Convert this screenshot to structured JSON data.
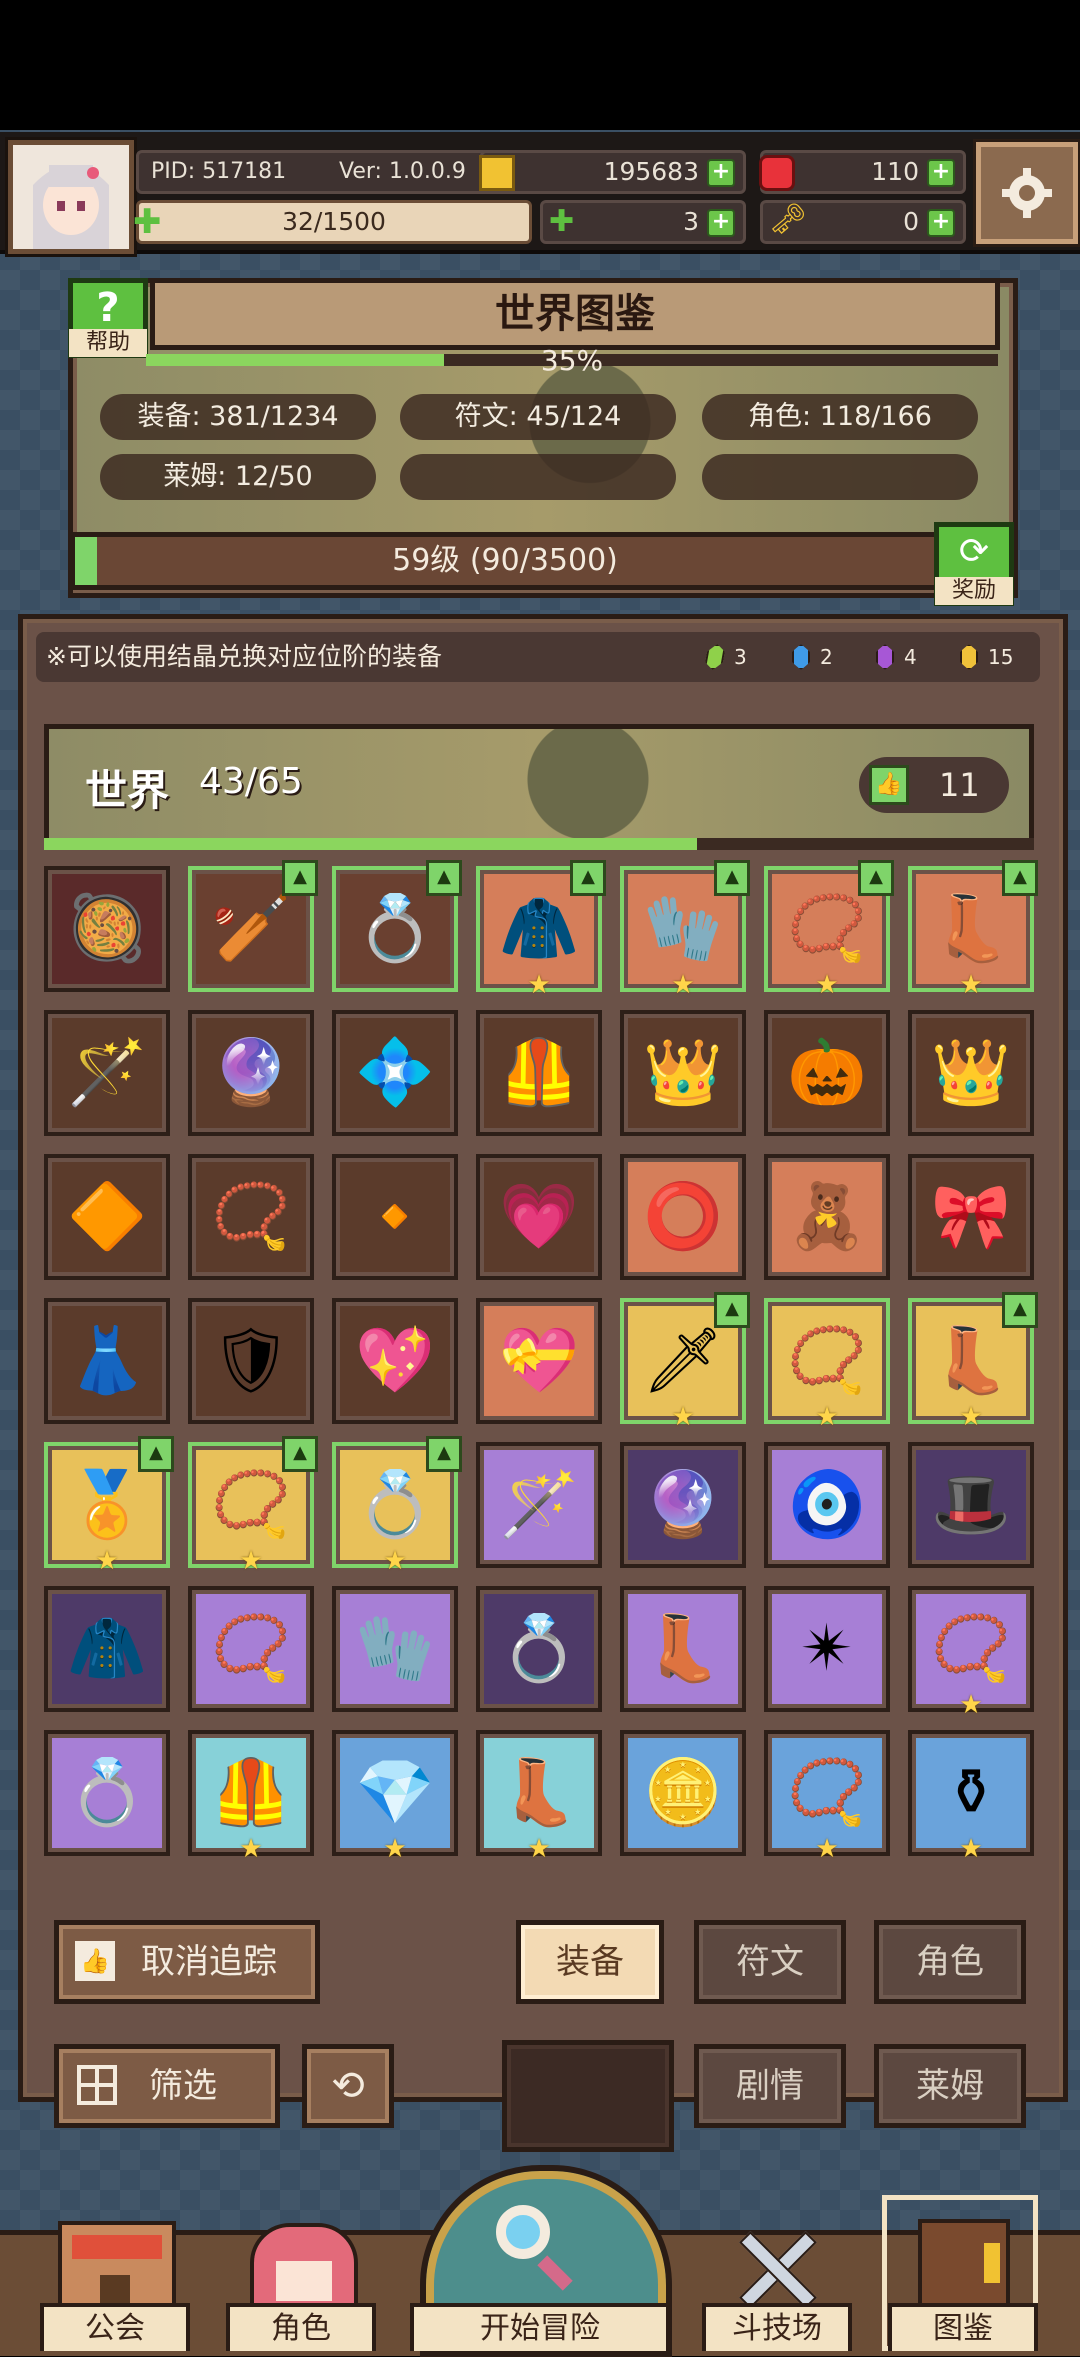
{
  "header": {
    "pid": "PID: 517181",
    "version": "Ver: 1.0.0.9",
    "gold": "195683",
    "gems": "110",
    "stamina": "32/1500",
    "clover": "3",
    "key": "0"
  },
  "codex": {
    "title": "世界图鉴",
    "help": "帮助",
    "percent": "35%",
    "percent_value": 0.35,
    "stats": [
      "装备: 381/1234",
      "符文: 45/124",
      "角色: 118/166",
      "莱姆: 12/50"
    ],
    "level": "59级 (90/3500)",
    "level_fraction": 0.026,
    "reward": "奖励"
  },
  "collection": {
    "note": "※可以使用结晶兑换对应位阶的装备",
    "crystals": [
      {
        "color": "#8fd14a",
        "count": "3"
      },
      {
        "color": "#3f9be8",
        "count": "2"
      },
      {
        "color": "#a757d6",
        "count": "4"
      },
      {
        "color": "#f0c23a",
        "count": "15"
      }
    ],
    "world_label": "世界",
    "world_count": "43/65",
    "world_fraction": 0.66,
    "likes": "11"
  },
  "grid": [
    {
      "r": "r-red",
      "g": "🥘",
      "hl": false,
      "star": false,
      "thumb": false
    },
    {
      "r": "r-brown",
      "g": "🏏",
      "hl": true,
      "star": false,
      "thumb": true
    },
    {
      "r": "r-brown",
      "g": "💍",
      "hl": true,
      "star": false,
      "thumb": true
    },
    {
      "r": "r-orange",
      "g": "🧥",
      "hl": true,
      "star": true,
      "thumb": true
    },
    {
      "r": "r-orange",
      "g": "🧤",
      "hl": true,
      "star": true,
      "thumb": true
    },
    {
      "r": "r-orange",
      "g": "📿",
      "hl": true,
      "star": true,
      "thumb": true
    },
    {
      "r": "r-orange",
      "g": "👢",
      "hl": true,
      "star": true,
      "thumb": true
    },
    {
      "r": "r-brown2",
      "g": "🪄",
      "hl": false,
      "star": false,
      "thumb": false
    },
    {
      "r": "r-brown2",
      "g": "🔮",
      "hl": false,
      "star": false,
      "thumb": false
    },
    {
      "r": "r-brown2",
      "g": "💠",
      "hl": false,
      "star": false,
      "thumb": false
    },
    {
      "r": "r-brown2",
      "g": "🦺",
      "hl": false,
      "star": false,
      "thumb": false
    },
    {
      "r": "r-brown2",
      "g": "👑",
      "hl": false,
      "star": false,
      "thumb": false
    },
    {
      "r": "r-brown2",
      "g": "🎃",
      "hl": false,
      "star": false,
      "thumb": false
    },
    {
      "r": "r-brown2",
      "g": "👑",
      "hl": false,
      "star": false,
      "thumb": false
    },
    {
      "r": "r-brown2",
      "g": "🔶",
      "hl": false,
      "star": false,
      "thumb": false
    },
    {
      "r": "r-brown2",
      "g": "📿",
      "hl": false,
      "star": false,
      "thumb": false
    },
    {
      "r": "r-brown2",
      "g": "🔸",
      "hl": false,
      "star": false,
      "thumb": false
    },
    {
      "r": "r-brown2",
      "g": "💗",
      "hl": false,
      "star": false,
      "thumb": false
    },
    {
      "r": "r-orange",
      "g": "⭕",
      "hl": false,
      "star": false,
      "thumb": false
    },
    {
      "r": "r-orange",
      "g": "🧸",
      "hl": false,
      "star": false,
      "thumb": false
    },
    {
      "r": "r-brown2",
      "g": "🎀",
      "hl": false,
      "star": false,
      "thumb": false
    },
    {
      "r": "r-brown2",
      "g": "👗",
      "hl": false,
      "star": false,
      "thumb": false
    },
    {
      "r": "r-brown2",
      "g": "🛡",
      "hl": false,
      "star": false,
      "thumb": false
    },
    {
      "r": "r-brown2",
      "g": "💖",
      "hl": false,
      "star": false,
      "thumb": false
    },
    {
      "r": "r-orange",
      "g": "💝",
      "hl": false,
      "star": false,
      "thumb": false
    },
    {
      "r": "r-gold",
      "g": "🗡",
      "hl": true,
      "star": true,
      "thumb": true
    },
    {
      "r": "r-gold",
      "g": "📿",
      "hl": true,
      "star": true,
      "thumb": false
    },
    {
      "r": "r-gold",
      "g": "👢",
      "hl": true,
      "star": true,
      "thumb": true
    },
    {
      "r": "r-gold",
      "g": "🏅",
      "hl": true,
      "star": true,
      "thumb": true
    },
    {
      "r": "r-gold",
      "g": "📿",
      "hl": true,
      "star": true,
      "thumb": true
    },
    {
      "r": "r-gold",
      "g": "💍",
      "hl": true,
      "star": true,
      "thumb": true
    },
    {
      "r": "r-purple",
      "g": "🪄",
      "hl": false,
      "star": false,
      "thumb": false
    },
    {
      "r": "r-dpurple",
      "g": "🔮",
      "hl": false,
      "star": false,
      "thumb": false
    },
    {
      "r": "r-purple",
      "g": "🧿",
      "hl": false,
      "star": false,
      "thumb": false
    },
    {
      "r": "r-dpurple",
      "g": "🎩",
      "hl": false,
      "star": false,
      "thumb": false
    },
    {
      "r": "r-dpurple",
      "g": "🧥",
      "hl": false,
      "star": false,
      "thumb": false
    },
    {
      "r": "r-purple",
      "g": "📿",
      "hl": false,
      "star": false,
      "thumb": false
    },
    {
      "r": "r-purple",
      "g": "🧤",
      "hl": false,
      "star": false,
      "thumb": false
    },
    {
      "r": "r-dpurple",
      "g": "💍",
      "hl": false,
      "star": false,
      "thumb": false
    },
    {
      "r": "r-purple",
      "g": "👢",
      "hl": false,
      "star": false,
      "thumb": false
    },
    {
      "r": "r-purple",
      "g": "✴",
      "hl": false,
      "star": false,
      "thumb": false
    },
    {
      "r": "r-purple",
      "g": "📿",
      "hl": false,
      "star": true,
      "thumb": false
    },
    {
      "r": "r-purple",
      "g": "💍",
      "hl": false,
      "star": false,
      "thumb": false
    },
    {
      "r": "r-teal",
      "g": "🦺",
      "hl": false,
      "star": true,
      "thumb": false
    },
    {
      "r": "r-blue",
      "g": "💎",
      "hl": false,
      "star": true,
      "thumb": false
    },
    {
      "r": "r-teal",
      "g": "👢",
      "hl": false,
      "star": true,
      "thumb": false
    },
    {
      "r": "r-blue",
      "g": "🪙",
      "hl": false,
      "star": false,
      "thumb": false
    },
    {
      "r": "r-blue",
      "g": "📿",
      "hl": false,
      "star": true,
      "thumb": false
    },
    {
      "r": "r-blue",
      "g": "⚱",
      "hl": false,
      "star": true,
      "thumb": false
    }
  ],
  "buttons": {
    "untrack": "取消追踪",
    "filter": "筛选",
    "tab_equipment": "装备",
    "tab_rune": "符文",
    "tab_character": "角色",
    "tab_story": "剧情",
    "tab_slime": "莱姆"
  },
  "nav": {
    "guild": "公会",
    "character": "角色",
    "adventure": "开始冒险",
    "arena": "斗技场",
    "codex": "图鉴"
  }
}
